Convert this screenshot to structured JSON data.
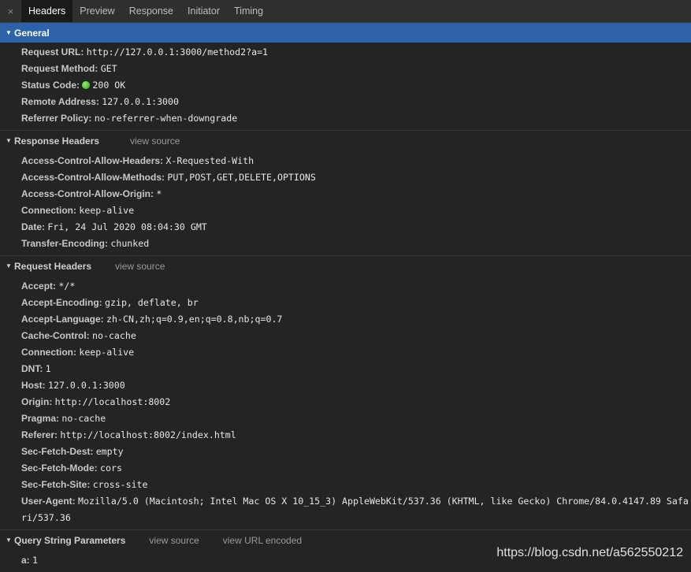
{
  "tabs": {
    "close_glyph": "×",
    "items": [
      "Headers",
      "Preview",
      "Response",
      "Initiator",
      "Timing"
    ],
    "active": "Headers"
  },
  "general": {
    "title": "General",
    "rows": [
      {
        "key": "Request URL:",
        "value": "http://127.0.0.1:3000/method2?a=1"
      },
      {
        "key": "Request Method:",
        "value": "GET"
      },
      {
        "key": "Status Code:",
        "value": "200 OK"
      },
      {
        "key": "Remote Address:",
        "value": "127.0.0.1:3000"
      },
      {
        "key": "Referrer Policy:",
        "value": "no-referrer-when-downgrade"
      }
    ]
  },
  "response_headers": {
    "title": "Response Headers",
    "view_source": "view source",
    "rows": [
      {
        "key": "Access-Control-Allow-Headers:",
        "value": "X-Requested-With"
      },
      {
        "key": "Access-Control-Allow-Methods:",
        "value": "PUT,POST,GET,DELETE,OPTIONS"
      },
      {
        "key": "Access-Control-Allow-Origin:",
        "value": "*"
      },
      {
        "key": "Connection:",
        "value": "keep-alive"
      },
      {
        "key": "Date:",
        "value": "Fri, 24 Jul 2020 08:04:30 GMT"
      },
      {
        "key": "Transfer-Encoding:",
        "value": "chunked"
      }
    ]
  },
  "request_headers": {
    "title": "Request Headers",
    "view_source": "view source",
    "rows": [
      {
        "key": "Accept:",
        "value": "*/*"
      },
      {
        "key": "Accept-Encoding:",
        "value": "gzip, deflate, br"
      },
      {
        "key": "Accept-Language:",
        "value": "zh-CN,zh;q=0.9,en;q=0.8,nb;q=0.7"
      },
      {
        "key": "Cache-Control:",
        "value": "no-cache"
      },
      {
        "key": "Connection:",
        "value": "keep-alive"
      },
      {
        "key": "DNT:",
        "value": "1"
      },
      {
        "key": "Host:",
        "value": "127.0.0.1:3000"
      },
      {
        "key": "Origin:",
        "value": "http://localhost:8002"
      },
      {
        "key": "Pragma:",
        "value": "no-cache"
      },
      {
        "key": "Referer:",
        "value": "http://localhost:8002/index.html"
      },
      {
        "key": "Sec-Fetch-Dest:",
        "value": "empty"
      },
      {
        "key": "Sec-Fetch-Mode:",
        "value": "cors"
      },
      {
        "key": "Sec-Fetch-Site:",
        "value": "cross-site"
      },
      {
        "key": "User-Agent:",
        "value": "Mozilla/5.0 (Macintosh; Intel Mac OS X 10_15_3) AppleWebKit/537.36 (KHTML, like Gecko) Chrome/84.0.4147.89 Safari/537.36"
      }
    ]
  },
  "query_params": {
    "title": "Query String Parameters",
    "view_source": "view source",
    "view_url_encoded": "view URL encoded",
    "rows": [
      {
        "key": "a:",
        "value": "1"
      }
    ]
  },
  "watermark": "https://blog.csdn.net/a562550212",
  "colors": {
    "selected_header": "#2e62a8",
    "status_ok": "#3aa622",
    "background": "#242424"
  }
}
